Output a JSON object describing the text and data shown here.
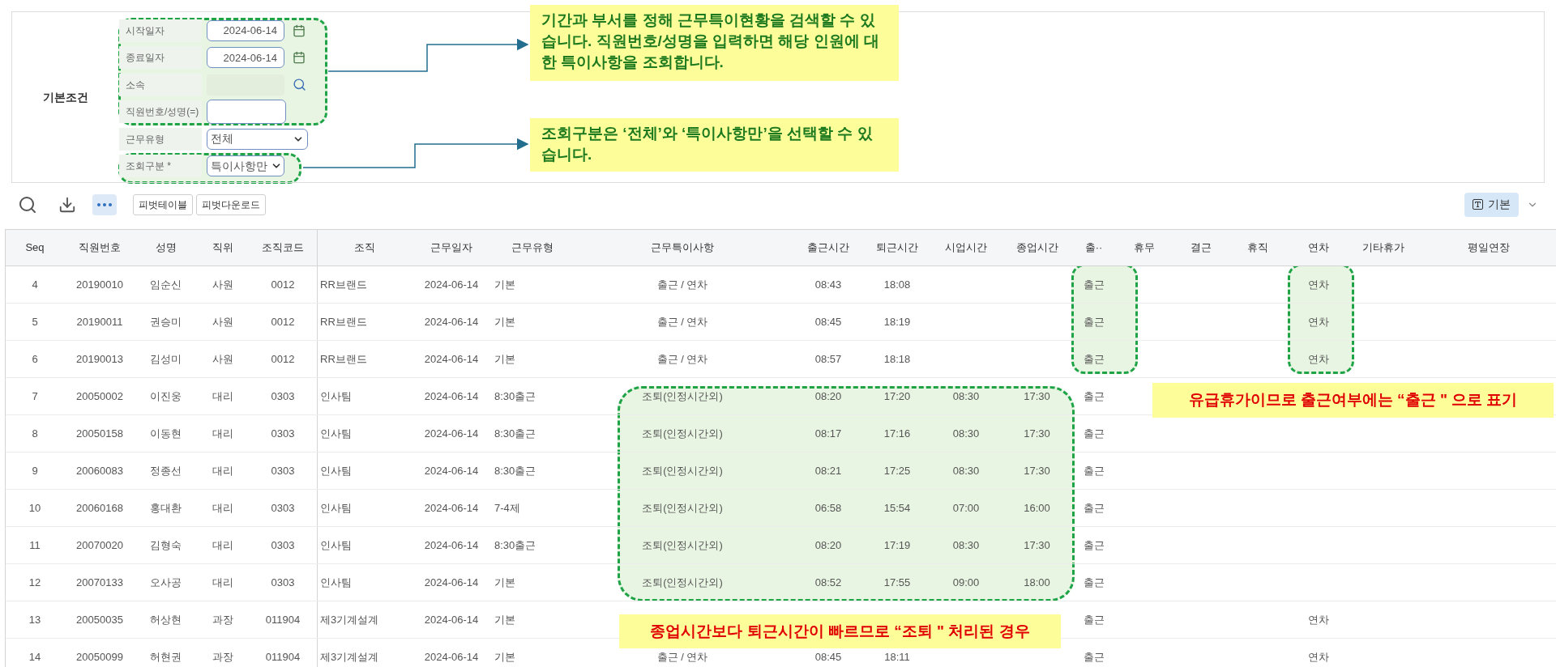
{
  "search_panel": {
    "section_label": "기본조건",
    "fields": [
      {
        "kind": "date",
        "label": "시작일자",
        "value": "2024-06-14"
      },
      {
        "kind": "date",
        "label": "종료일자",
        "value": "2024-06-14"
      },
      {
        "kind": "lookup",
        "label": "소속"
      },
      {
        "kind": "text",
        "label": "직원번호/성명(=)"
      },
      {
        "kind": "select",
        "label": "근무유형",
        "value": "전체"
      },
      {
        "kind": "select",
        "label": "조회구분 *",
        "value": "특이사항만"
      }
    ]
  },
  "toolbar": {
    "buttons": [
      "피벗테이블",
      "피벗다운로드"
    ],
    "view_button": "기본"
  },
  "table": {
    "columns": [
      "Seq",
      "직원번호",
      "성명",
      "직위",
      "조직코드",
      "조직",
      "근무일자",
      "근무유형",
      "근무특이사항",
      "출근시간",
      "퇴근시간",
      "시업시간",
      "종업시간",
      "출··",
      "휴무",
      "결근",
      "휴직",
      "연차",
      "기타휴가",
      "평일연장"
    ],
    "rows": [
      [
        "4",
        "20190010",
        "임순신",
        "사원",
        "0012",
        "RR브랜드",
        "2024-06-14",
        "기본",
        "출근 / 연차",
        "08:43",
        "18:08",
        null,
        null,
        "출근",
        null,
        null,
        null,
        "연차",
        null,
        null
      ],
      [
        "5",
        "20190011",
        "권승미",
        "사원",
        "0012",
        "RR브랜드",
        "2024-06-14",
        "기본",
        "출근 / 연차",
        "08:45",
        "18:19",
        null,
        null,
        "출근",
        null,
        null,
        null,
        "연차",
        null,
        null
      ],
      [
        "6",
        "20190013",
        "김성미",
        "사원",
        "0012",
        "RR브랜드",
        "2024-06-14",
        "기본",
        "출근 / 연차",
        "08:57",
        "18:18",
        null,
        null,
        "출근",
        null,
        null,
        null,
        "연차",
        null,
        null
      ],
      [
        "7",
        "20050002",
        "이진웅",
        "대리",
        "0303",
        "인사팀",
        "2024-06-14",
        "8:30출근",
        "조퇴(인정시간외)",
        "08:20",
        "17:20",
        "08:30",
        "17:30",
        "출근",
        null,
        null,
        null,
        null,
        null,
        null
      ],
      [
        "8",
        "20050158",
        "이동현",
        "대리",
        "0303",
        "인사팀",
        "2024-06-14",
        "8:30출근",
        "조퇴(인정시간외)",
        "08:17",
        "17:16",
        "08:30",
        "17:30",
        "출근",
        null,
        null,
        null,
        null,
        null,
        null
      ],
      [
        "9",
        "20060083",
        "정종선",
        "대리",
        "0303",
        "인사팀",
        "2024-06-14",
        "8:30출근",
        "조퇴(인정시간외)",
        "08:21",
        "17:25",
        "08:30",
        "17:30",
        "출근",
        null,
        null,
        null,
        null,
        null,
        null
      ],
      [
        "10",
        "20060168",
        "홍대환",
        "대리",
        "0303",
        "인사팀",
        "2024-06-14",
        "7-4제",
        "조퇴(인정시간외)",
        "06:58",
        "15:54",
        "07:00",
        "16:00",
        "출근",
        null,
        null,
        null,
        null,
        null,
        null
      ],
      [
        "11",
        "20070020",
        "김형숙",
        "대리",
        "0303",
        "인사팀",
        "2024-06-14",
        "8:30출근",
        "조퇴(인정시간외)",
        "08:20",
        "17:19",
        "08:30",
        "17:30",
        "출근",
        null,
        null,
        null,
        null,
        null,
        null
      ],
      [
        "12",
        "20070133",
        "오사공",
        "대리",
        "0303",
        "인사팀",
        "2024-06-14",
        "기본",
        "조퇴(인정시간외)",
        "08:52",
        "17:55",
        "09:00",
        "18:00",
        "출근",
        null,
        null,
        null,
        null,
        null,
        null
      ],
      [
        "13",
        "20050035",
        "허상현",
        "과장",
        "011904",
        "제3기계설계",
        "2024-06-14",
        "기본",
        null,
        null,
        null,
        null,
        null,
        "출근",
        null,
        null,
        null,
        "연차",
        null,
        null
      ],
      [
        "14",
        "20050099",
        "허현권",
        "과장",
        "011904",
        "제3기계설계",
        "2024-06-14",
        "기본",
        "출근 / 연차",
        "08:45",
        "18:11",
        null,
        null,
        "출근",
        null,
        null,
        null,
        "연차",
        null,
        null
      ]
    ]
  },
  "notes": [
    {
      "text": "기간과 부서를 정해 근무특이현황을 검색할 수 있습니다. 직원번호/성명을 입력하면 해당 인원에 대한 특이사항을 조회합니다.",
      "color": "#1e7a1e"
    },
    {
      "text": "조회구분은 ‘전체’와 ‘특이사항만’을 선택할 수 있습니다.",
      "color": "#1e7a1e"
    },
    {
      "text": "유급휴가이므로 출근여부에는 “출근 \" 으로 표기",
      "color": "#e00000"
    },
    {
      "text": "종업시간보다 퇴근시간이 빠르므로 “조퇴 \" 처리된 경우",
      "color": "#e00000"
    }
  ]
}
